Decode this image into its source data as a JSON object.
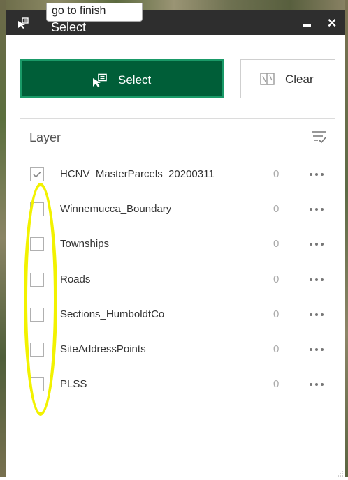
{
  "tooltip": {
    "text": "go to finish"
  },
  "titlebar": {
    "title": "Select",
    "icon": "select-widget-icon"
  },
  "buttons": {
    "select_label": "Select",
    "clear_label": "Clear"
  },
  "layers": {
    "header": "Layer",
    "items": [
      {
        "name": "HCNV_MasterParcels_20200311",
        "count": "0",
        "checked": true
      },
      {
        "name": "Winnemucca_Boundary",
        "count": "0",
        "checked": false
      },
      {
        "name": "Townships",
        "count": "0",
        "checked": false
      },
      {
        "name": "Roads",
        "count": "0",
        "checked": false
      },
      {
        "name": "Sections_HumboldtCo",
        "count": "0",
        "checked": false
      },
      {
        "name": "SiteAddressPoints",
        "count": "0",
        "checked": false
      },
      {
        "name": "PLSS",
        "count": "0",
        "checked": false
      }
    ]
  },
  "colors": {
    "accent": "#005e38",
    "accent_border": "#1a9a68",
    "titlebar": "#2e2e2e",
    "highlight": "#f2f200"
  }
}
